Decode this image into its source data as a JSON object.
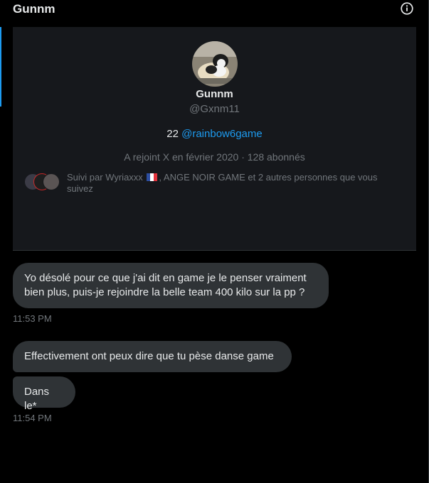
{
  "header": {
    "title": "Gunnm",
    "info_icon": "info-circle-icon"
  },
  "profile": {
    "name": "Gunnm",
    "handle": "@Gxnm11",
    "bio_text": "22 ",
    "bio_link": "@rainbow6game",
    "meta": "A rejoint X en février 2020 · 128 abonnés",
    "followed_by_prefix": "Suivi par Wyriaxxx ",
    "followed_by_suffix": ", ANGE NOIR GAME et 2 autres personnes que vous suivez"
  },
  "messages": [
    {
      "text": "Yo désolé pour ce que j'ai dit en game je le penser vraiment bien plus, puis-je rejoindre la belle team 400 kilo sur la pp ?"
    },
    {
      "text": "Effectivement ont peux dire que tu pèse danse game"
    },
    {
      "text": "Dans le*"
    }
  ],
  "timestamps": [
    "11:53 PM",
    "11:54 PM"
  ],
  "colors": {
    "background": "#000000",
    "card": "#16181c",
    "bubble": "#2f3336",
    "accent": "#1d9bf0",
    "muted": "#71767b"
  }
}
